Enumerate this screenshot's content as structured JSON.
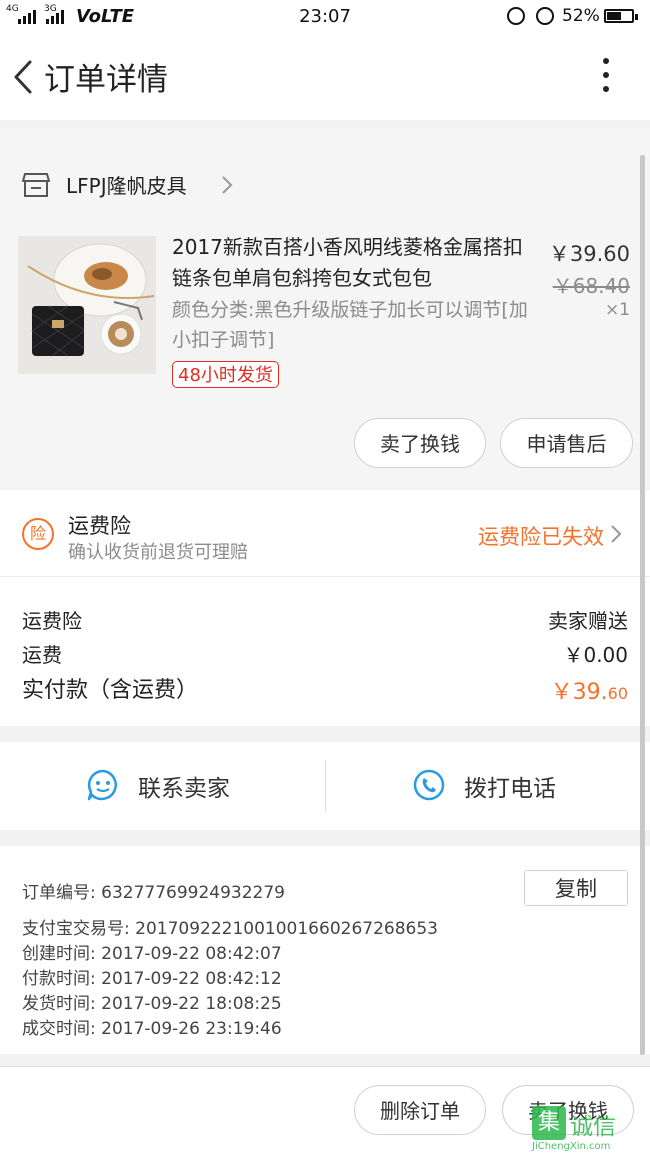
{
  "status_bar": {
    "net1": "4G",
    "net2": "3G",
    "carrier": "VoLTE",
    "time": "23:07",
    "battery": "52%"
  },
  "header": {
    "title": "订单详情"
  },
  "shop": {
    "name": "LFPJ隆帆皮具"
  },
  "product": {
    "title": "2017新款百搭小香风明线菱格金属搭扣链条包单肩包斜挎包女式包包",
    "sku": "颜色分类:黑色升级版链子加长可以调节[加小扣子调节]",
    "tag": "48小时发货",
    "price": "￥39.60",
    "original_price": "￥68.40",
    "quantity": "×1",
    "action_sell": "卖了换钱",
    "action_aftersale": "申请售后"
  },
  "insurance": {
    "icon_char": "险",
    "title": "运费险",
    "subtitle": "确认收货前退货可理赔",
    "status": "运费险已失效"
  },
  "fees": {
    "insurance_label": "运费险",
    "insurance_value": "卖家赠送",
    "shipping_label": "运费",
    "shipping_value": "￥0.00",
    "total_label": "实付款（含运费）",
    "total_value_main": "￥39.",
    "total_value_dec": "60"
  },
  "contact": {
    "seller_label": "联系卖家",
    "phone_label": "拨打电话"
  },
  "order_info": {
    "order_no": "订单编号:   63277769924932279",
    "copy_label": "复制",
    "alipay_no": "支付宝交易号:   2017092221001001660267268653",
    "created": "创建时间:   2017-09-22  08:42:07",
    "paid": "付款时间:   2017-09-22  08:42:12",
    "shipped": "发货时间:   2017-09-22  18:08:25",
    "completed": "成交时间:   2017-09-26  23:19:46"
  },
  "bottom_bar": {
    "delete_label": "删除订单",
    "sell_label": "卖了换钱"
  },
  "watermark": {
    "char": "集",
    "text": "诚信",
    "url": "JiChengXin.com"
  },
  "colors": {
    "accent_orange": "#f5722a",
    "tag_red": "#e02e24",
    "icon_blue": "#2a9be0"
  }
}
